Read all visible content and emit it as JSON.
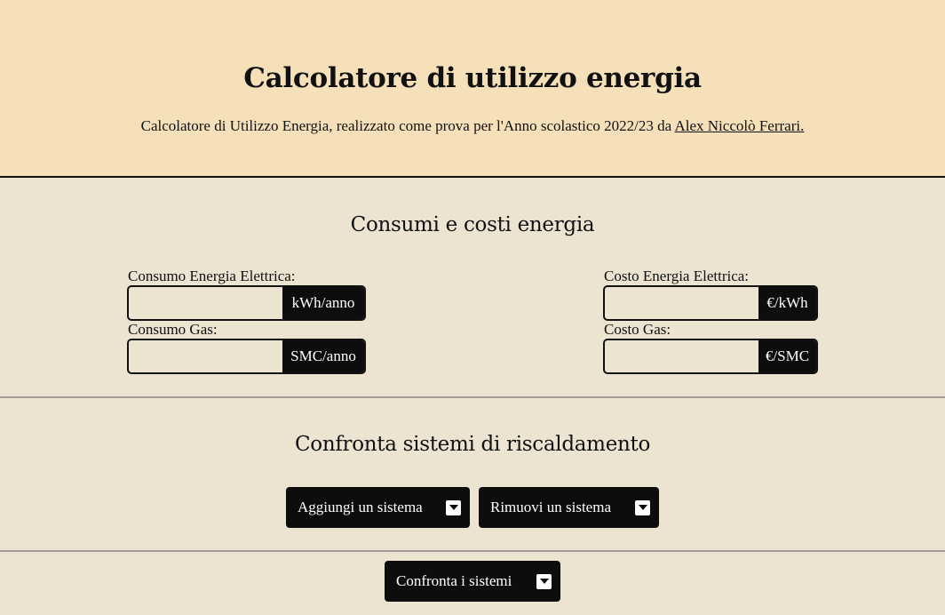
{
  "header": {
    "title": "Calcolatore di utilizzo energia",
    "subtitle_prefix": "Calcolatore di Utilizzo Energia, realizzato come prova per l'Anno scolastico 2022/23 da ",
    "author_link": "Alex Niccolò Ferrari."
  },
  "consumi": {
    "title": "Consumi e costi energia",
    "electric_consumption": {
      "label": "Consumo Energia Elettrica:",
      "unit": "kWh/anno",
      "value": ""
    },
    "gas_consumption": {
      "label": "Consumo Gas:",
      "unit": "SMC/anno",
      "value": ""
    },
    "electric_cost": {
      "label": "Costo Energia Elettrica:",
      "unit": "€/kWh",
      "value": ""
    },
    "gas_cost": {
      "label": "Costo Gas:",
      "unit": "€/SMC",
      "value": ""
    }
  },
  "confronta": {
    "title": "Confronta sistemi di riscaldamento",
    "add_label": "Aggiungi un sistema",
    "remove_label": "Rimuovi un sistema",
    "compare_label": "Confronta i sistemi"
  }
}
